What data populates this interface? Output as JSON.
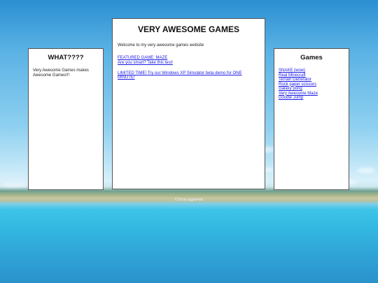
{
  "left_panel": {
    "title": "WHAT????",
    "text": "Very Awesome Games makes Awesome Games!!!"
  },
  "center_panel": {
    "title": "VERY AWESOME GAMES",
    "welcome": "Welcome to my very awesome games website",
    "featured_link": "FEATURED GAME: MAZE",
    "smart_link": "Are you smart? Take this test!",
    "limited_link": "LIMITED TIME! Try our Windows XP Simulator beta demo for ONE MINUTE!"
  },
  "right_panel": {
    "title": "Games",
    "games": [
      "SNAKE (wow)",
      "Real Minecraft",
      "Terrain Generator",
      "Rock paper scissors",
      "Galaxy pong",
      "Very Awesome Maze",
      "Doodle Jump"
    ]
  },
  "footer": {
    "credit": "CSS by yggramon"
  }
}
